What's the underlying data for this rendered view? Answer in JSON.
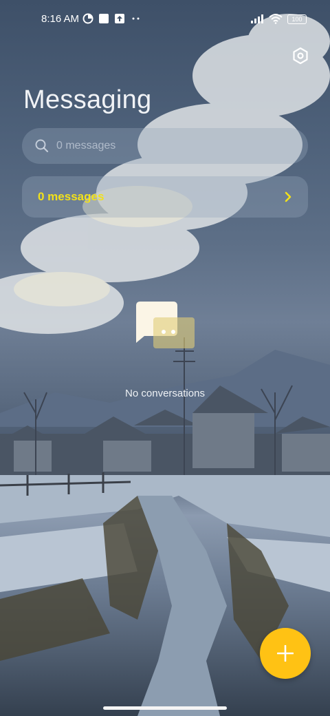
{
  "status_bar": {
    "time": "8:16 AM",
    "battery": "100",
    "icons": [
      "data-saver-icon",
      "notification-square-icon",
      "upload-icon",
      "more-dots-icon",
      "signal-icon",
      "wifi-icon",
      "battery-icon"
    ]
  },
  "header": {
    "title": "Messaging",
    "settings_icon": "gear-hex-icon"
  },
  "search": {
    "placeholder": "0 messages"
  },
  "messages_card": {
    "label": "0 messages",
    "accent_color": "#f2e11a"
  },
  "empty_state": {
    "text": "No conversations",
    "icon": "chat-bubbles-icon"
  },
  "fab": {
    "icon": "plus-icon",
    "color": "#ffc214"
  }
}
